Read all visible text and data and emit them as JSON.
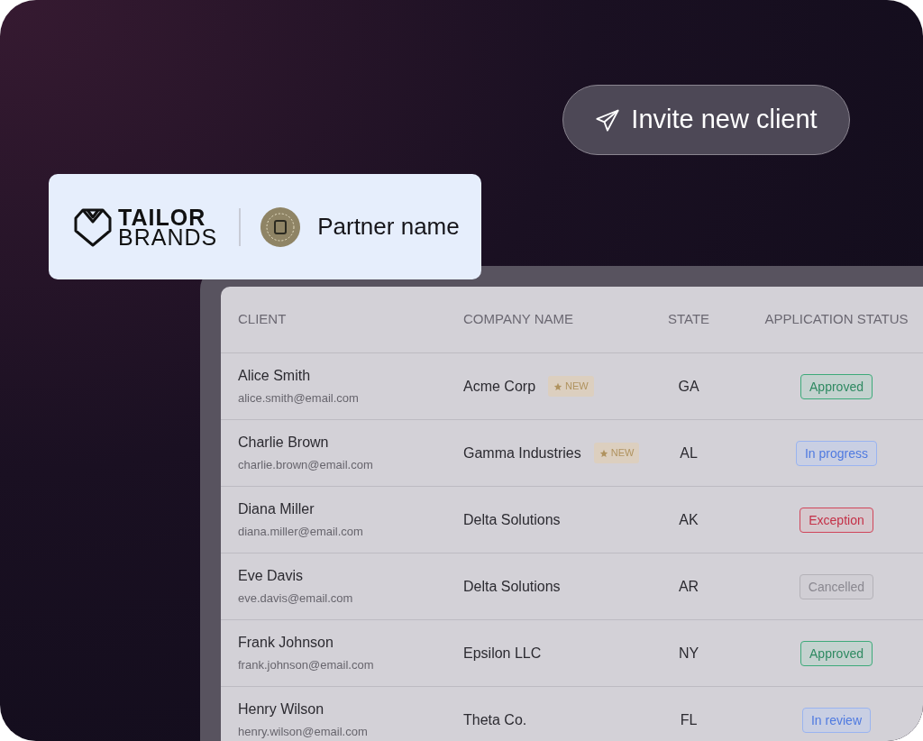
{
  "invite_button": {
    "label": "Invite new client"
  },
  "brand_card": {
    "logo_top": "TAILOR",
    "logo_bottom": "BRANDS",
    "partner_name": "Partner name"
  },
  "table": {
    "columns": [
      "CLIENT",
      "COMPANY NAME",
      "STATE",
      "APPLICATION STATUS"
    ],
    "rows": [
      {
        "name": "Alice Smith",
        "email": "alice.smith@email.com",
        "company": "Acme Corp",
        "new_badge": "NEW",
        "state": "GA",
        "status": "Approved",
        "kind": "approved"
      },
      {
        "name": "Charlie Brown",
        "email": "charlie.brown@email.com",
        "company": "Gamma Industries",
        "new_badge": "NEW",
        "state": "AL",
        "status": "In progress",
        "kind": "progress"
      },
      {
        "name": "Diana Miller",
        "email": "diana.miller@email.com",
        "company": "Delta Solutions",
        "state": "AK",
        "status": "Exception",
        "kind": "exception"
      },
      {
        "name": "Eve Davis",
        "email": "eve.davis@email.com",
        "company": "Delta Solutions",
        "state": "AR",
        "status": "Cancelled",
        "kind": "cancelled"
      },
      {
        "name": "Frank Johnson",
        "email": "frank.johnson@email.com",
        "company": "Epsilon LLC",
        "state": "NY",
        "status": "Approved",
        "kind": "approved"
      },
      {
        "name": "Henry Wilson",
        "email": "henry.wilson@email.com",
        "company": "Theta Co.",
        "state": "FL",
        "status": "In review",
        "kind": "review"
      }
    ]
  }
}
